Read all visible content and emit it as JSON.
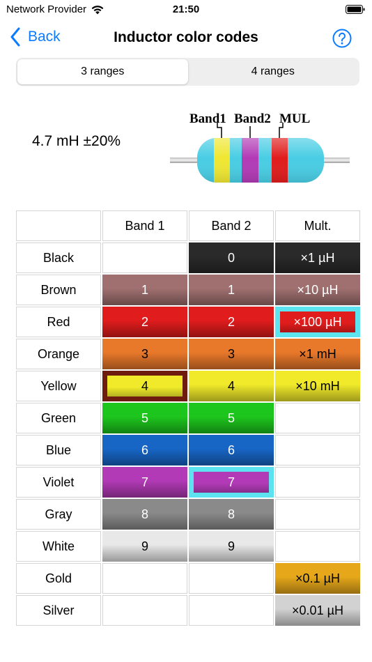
{
  "status_bar": {
    "carrier": "Network Provider",
    "time": "21:50"
  },
  "nav": {
    "back_label": "Back",
    "title": "Inductor color codes"
  },
  "segments": [
    {
      "label": "3 ranges",
      "selected": true
    },
    {
      "label": "4 ranges",
      "selected": false
    }
  ],
  "result": {
    "value": "4.7 mH ±20%"
  },
  "figure": {
    "labels": [
      "Band1",
      "Band2",
      "MUL"
    ],
    "body_color": "#48cde4",
    "band_colors": [
      "#efe731",
      "#b23ab6",
      "#e01c1c"
    ]
  },
  "table": {
    "headers": [
      "",
      "Band 1",
      "Band 2",
      "Mult."
    ],
    "rows": [
      {
        "name": "Black",
        "base": "#2a2a2a",
        "light": false,
        "band1": "",
        "band2": "0",
        "mult": "×1 µH"
      },
      {
        "name": "Brown",
        "base": "#a07070",
        "light": false,
        "band1": "1",
        "band2": "1",
        "mult": "×10 µH"
      },
      {
        "name": "Red",
        "base": "#e01c1c",
        "light": false,
        "band1": "2",
        "band2": "2",
        "mult": "×100 µH"
      },
      {
        "name": "Orange",
        "base": "#e8782a",
        "light": true,
        "band1": "3",
        "band2": "3",
        "mult": "×1 mH"
      },
      {
        "name": "Yellow",
        "base": "#f0ea2a",
        "light": true,
        "band1": "4",
        "band2": "4",
        "mult": "×10 mH"
      },
      {
        "name": "Green",
        "base": "#1dc61d",
        "light": false,
        "band1": "5",
        "band2": "5",
        "mult": ""
      },
      {
        "name": "Blue",
        "base": "#1766c6",
        "light": false,
        "band1": "6",
        "band2": "6",
        "mult": ""
      },
      {
        "name": "Violet",
        "base": "#b23ab6",
        "light": false,
        "band1": "7",
        "band2": "7",
        "mult": ""
      },
      {
        "name": "Gray",
        "base": "#8a8a8a",
        "light": false,
        "band1": "8",
        "band2": "8",
        "mult": ""
      },
      {
        "name": "White",
        "base": "#e8e8e8",
        "light": true,
        "band1": "9",
        "band2": "9",
        "mult": ""
      },
      {
        "name": "Gold",
        "base": "#e6a81a",
        "light": true,
        "band1": "",
        "band2": "",
        "mult": "×0.1 µH"
      },
      {
        "name": "Silver",
        "base": "#d2d2d2",
        "light": true,
        "band1": "",
        "band2": "",
        "mult": "×0.01 µH"
      }
    ],
    "selection": {
      "band1": {
        "row": "Yellow",
        "border": "#6e1c10"
      },
      "band2": {
        "row": "Violet",
        "border": "#5de2ef"
      },
      "mult": {
        "row": "Red",
        "border": "#5de2ef"
      }
    }
  }
}
